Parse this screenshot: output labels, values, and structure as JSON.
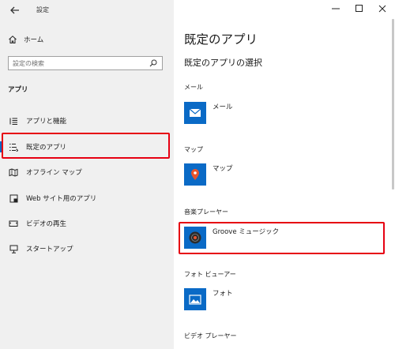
{
  "window": {
    "title": "設定",
    "back_icon": "back-arrow-icon",
    "controls": [
      "minimize-icon",
      "maximize-icon",
      "close-icon"
    ]
  },
  "sidebar": {
    "home_label": "ホーム",
    "search_placeholder": "設定の検索",
    "section_title": "アプリ",
    "items": [
      {
        "label": "アプリと機能",
        "icon": "list-icon"
      },
      {
        "label": "既定のアプリ",
        "icon": "default-apps-icon",
        "selected": true
      },
      {
        "label": "オフライン マップ",
        "icon": "offline-map-icon"
      },
      {
        "label": "Web サイト用のアプリ",
        "icon": "website-apps-icon"
      },
      {
        "label": "ビデオの再生",
        "icon": "video-icon"
      },
      {
        "label": "スタートアップ",
        "icon": "startup-icon"
      }
    ]
  },
  "main": {
    "title": "既定のアプリ",
    "subtitle": "既定のアプリの選択",
    "categories": [
      {
        "label": "メール",
        "app": "メール",
        "icon": "mail-icon"
      },
      {
        "label": "マップ",
        "app": "マップ",
        "icon": "maps-icon"
      },
      {
        "label": "音楽プレーヤー",
        "app": "Groove ミュージック",
        "icon": "groove-music-icon"
      },
      {
        "label": "フォト ビューアー",
        "app": "フォト",
        "icon": "photos-icon"
      },
      {
        "label": "ビデオ プレーヤー"
      }
    ]
  },
  "colors": {
    "accent": "#0a6ac6",
    "highlight": "#e60012",
    "sidebar_bg": "#f0f0f0"
  }
}
